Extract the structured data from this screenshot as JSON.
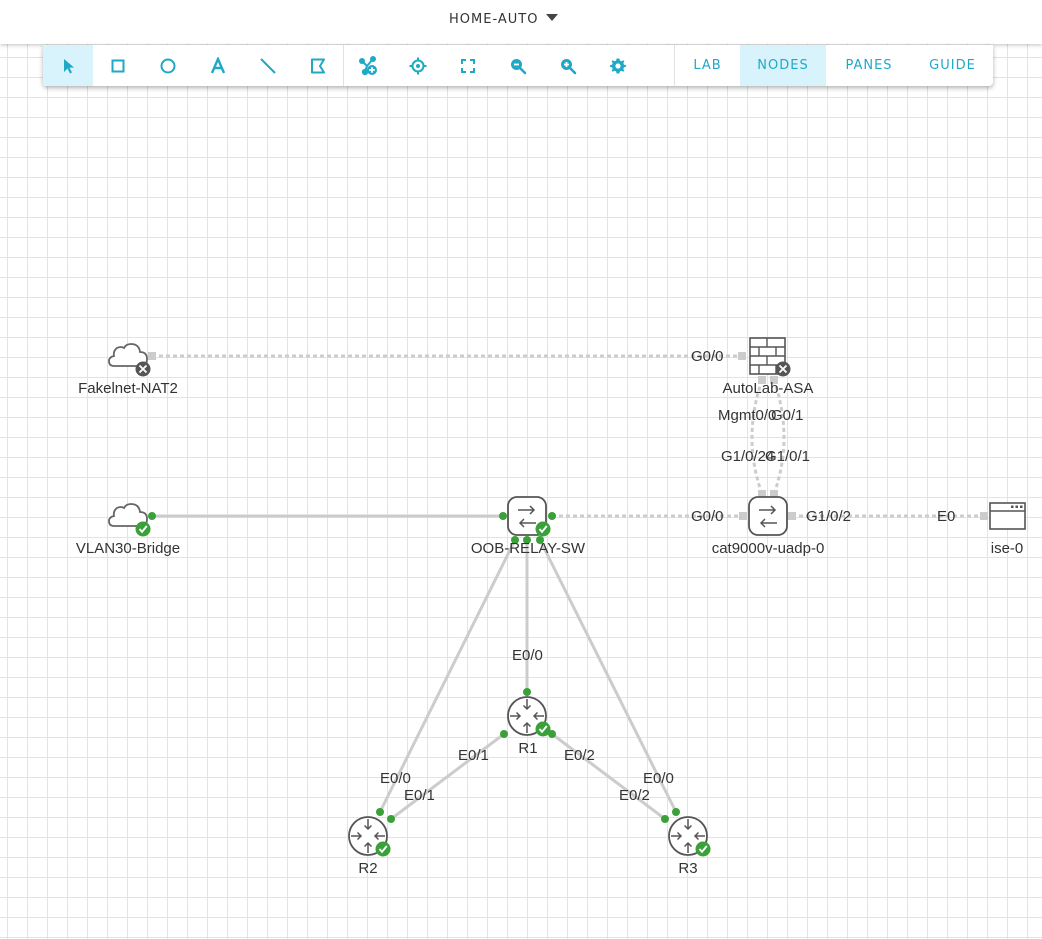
{
  "header": {
    "lab_title": "HOME-AUTO"
  },
  "toolbar": {
    "tools": [
      {
        "name": "select-tool",
        "icon": "cursor-arrow-icon",
        "active": true
      },
      {
        "name": "rectangle-tool",
        "icon": "square-icon",
        "active": false
      },
      {
        "name": "ellipse-tool",
        "icon": "circle-icon",
        "active": false
      },
      {
        "name": "text-tool",
        "icon": "letter-a-icon",
        "active": false
      },
      {
        "name": "line-tool",
        "icon": "diagonal-line-icon",
        "active": false
      },
      {
        "name": "freehand-tool",
        "icon": "flag-shape-icon",
        "active": false
      },
      {
        "name": "add-node-tool",
        "icon": "add-node-icon",
        "active": false
      },
      {
        "name": "center-view-tool",
        "icon": "crosshair-icon",
        "active": false
      },
      {
        "name": "fit-to-screen-tool",
        "icon": "fullscreen-icon",
        "active": false
      },
      {
        "name": "zoom-out-tool",
        "icon": "zoom-out-icon",
        "active": false
      },
      {
        "name": "zoom-in-tool",
        "icon": "zoom-in-icon",
        "active": false
      },
      {
        "name": "settings-tool",
        "icon": "gear-icon",
        "active": false
      }
    ],
    "tabs": [
      {
        "label": "LAB",
        "active": false
      },
      {
        "label": "NODES",
        "active": true
      },
      {
        "label": "PANES",
        "active": false
      },
      {
        "label": "GUIDE",
        "active": false
      }
    ],
    "accent_color": "#20a9c7",
    "active_bg_color": "#d8f3fb"
  },
  "topology": {
    "nodes": [
      {
        "id": "fakelnet",
        "label": "Fakelnet-NAT2",
        "type": "external-connector",
        "status": "stopped"
      },
      {
        "id": "vlan30",
        "label": "VLAN30-Bridge",
        "type": "external-connector",
        "status": "running"
      },
      {
        "id": "asa",
        "label": "AutoLab-ASA",
        "type": "firewall",
        "status": "stopped"
      },
      {
        "id": "oob",
        "label": "OOB-RELAY-SW",
        "type": "switch",
        "status": "running"
      },
      {
        "id": "cat9k",
        "label": "cat9000v-uadp-0",
        "type": "switch",
        "status": "stopped"
      },
      {
        "id": "ise",
        "label": "ise-0",
        "type": "server",
        "status": "stopped"
      },
      {
        "id": "r1",
        "label": "R1",
        "type": "router",
        "status": "running"
      },
      {
        "id": "r2",
        "label": "R2",
        "type": "router",
        "status": "running"
      },
      {
        "id": "r3",
        "label": "R3",
        "type": "router",
        "status": "running"
      }
    ],
    "links": [
      {
        "from": "fakelnet",
        "to": "asa",
        "state": "down",
        "from_if": "",
        "to_if": "G0/0"
      },
      {
        "from": "vlan30",
        "to": "oob",
        "state": "up",
        "from_if": "",
        "to_if": ""
      },
      {
        "from": "oob",
        "to": "cat9k",
        "state": "down",
        "from_if": "",
        "to_if": "G0/0"
      },
      {
        "from": "cat9k",
        "to": "ise",
        "state": "down",
        "from_if": "G1/0/2",
        "to_if": "E0"
      },
      {
        "from": "asa",
        "to": "cat9k",
        "state": "down",
        "from_if": "Mgmt0/0",
        "to_if": "G1/0/24"
      },
      {
        "from": "asa",
        "to": "cat9k",
        "state": "down",
        "from_if": "G0/1",
        "to_if": "G1/0/1"
      },
      {
        "from": "oob",
        "to": "r1",
        "state": "up",
        "from_if": "",
        "to_if": "E0/0"
      },
      {
        "from": "oob",
        "to": "r2",
        "state": "up",
        "from_if": "",
        "to_if": "E0/0"
      },
      {
        "from": "oob",
        "to": "r3",
        "state": "up",
        "from_if": "",
        "to_if": "E0/0"
      },
      {
        "from": "r1",
        "to": "r2",
        "state": "up",
        "from_if": "E0/1",
        "to_if": "E0/1"
      },
      {
        "from": "r1",
        "to": "r3",
        "state": "up",
        "from_if": "E0/2",
        "to_if": "E0/2"
      }
    ],
    "colors": {
      "link": "#cccccc",
      "running": "#3aa03a",
      "stopped": "#666666",
      "icon_stroke": "#555555"
    }
  }
}
